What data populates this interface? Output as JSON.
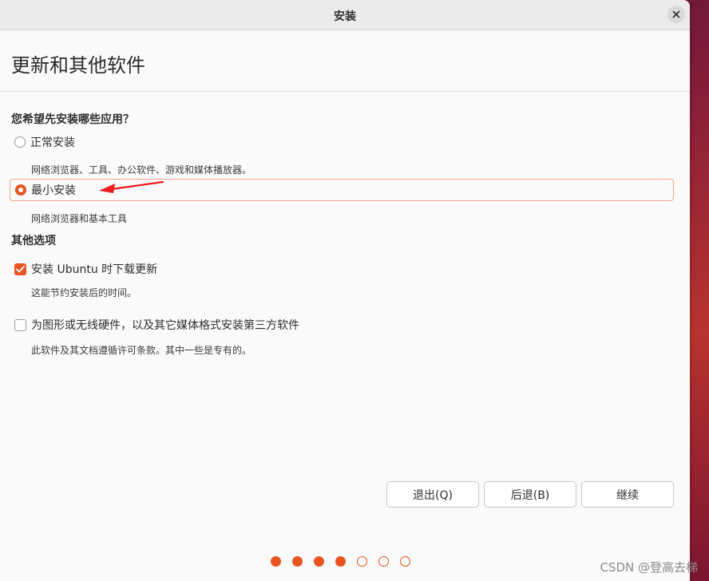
{
  "window": {
    "title": "安装",
    "close_icon": "close-icon"
  },
  "page": {
    "title": "更新和其他软件"
  },
  "install_type": {
    "question": "您希望先安装哪些应用？",
    "options": [
      {
        "label": "正常安装",
        "description": "网络浏览器、工具、办公软件、游戏和媒体播放器。",
        "selected": false
      },
      {
        "label": "最小安装",
        "description": "网络浏览器和基本工具",
        "selected": true
      }
    ]
  },
  "other_options": {
    "title": "其他选项",
    "items": [
      {
        "label": "安装 Ubuntu 时下载更新",
        "description": "这能节约安装后的时间。",
        "checked": true
      },
      {
        "label": "为图形或无线硬件，以及其它媒体格式安装第三方软件",
        "description": "此软件及其文档遵循许可条款。其中一些是专有的。",
        "checked": false
      }
    ]
  },
  "buttons": {
    "quit": "退出(Q)",
    "back": "后退(B)",
    "continue": "继续"
  },
  "progress": {
    "total_steps": 7,
    "completed_steps": 4
  },
  "watermark": "CSDN @登高去梯",
  "colors": {
    "accent": "#e95420",
    "annotation_arrow": "#ee1c1c",
    "selected_border": "#f1a889"
  }
}
